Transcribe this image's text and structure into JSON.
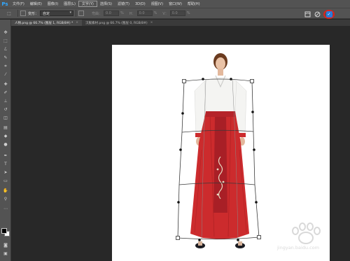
{
  "app": {
    "logo": "Ps"
  },
  "menu": [
    "文件(F)",
    "编辑(E)",
    "图像(I)",
    "图层(L)",
    "文字(Y)",
    "选择(S)",
    "滤镜(T)",
    "3D(D)",
    "视图(V)",
    "窗口(W)",
    "帮助(H)"
  ],
  "options": {
    "warp_label": "变形：",
    "warp_value": "自定",
    "bend_label": "弯曲：",
    "bend_value": "0.0",
    "bend_unit": "%",
    "h_label": "H：",
    "h_value": "0.0",
    "h_unit": "%",
    "v_label": "V：",
    "v_value": "0.0",
    "v_unit": "%"
  },
  "tabs": [
    {
      "label": "人物.png @ 66.7% (图层 1, RGB/8#) *",
      "close": "×"
    },
    {
      "label": "汉服素材.png @ 66.7% (图层 0, RGB/8#)",
      "close": "×"
    }
  ],
  "watermark": {
    "text": "jingyan.baidu.com"
  },
  "colors": {
    "accent_commit": "#2b7bd8",
    "highlight_circle": "#e0211d",
    "canvas_bg": "#ffffff",
    "workspace_bg": "#282828",
    "skirt": "#cc2b2d",
    "shirt": "#f4f4f2"
  },
  "icons": {
    "commit": "checkmark-icon",
    "cancel": "cancel-icon",
    "warp_toggle": "warp-toggle-icon"
  }
}
